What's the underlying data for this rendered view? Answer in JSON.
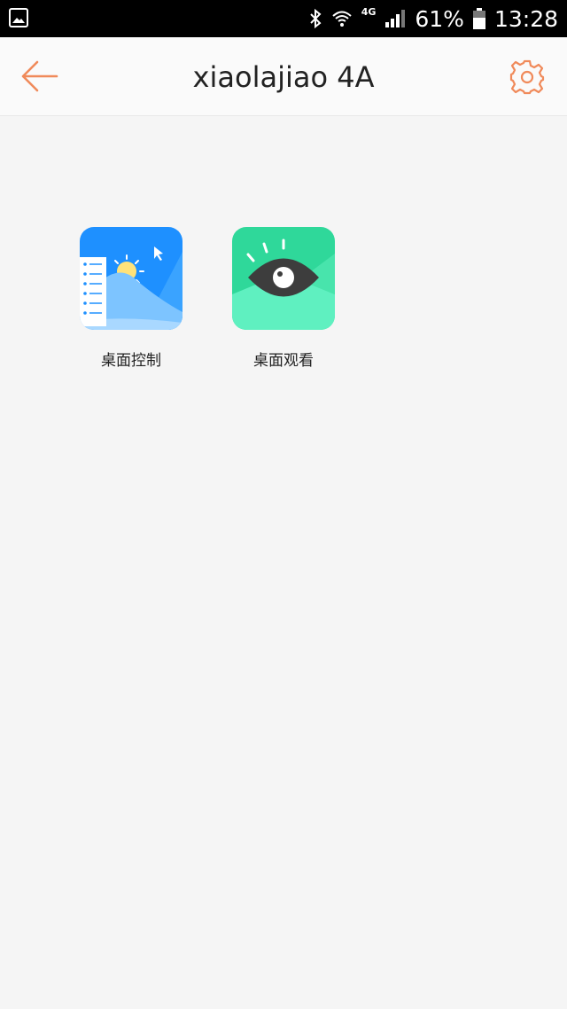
{
  "status_bar": {
    "network": "4G",
    "battery_percent": "61%",
    "time": "13:28",
    "icons": [
      "gallery-icon",
      "bluetooth-icon",
      "wifi-icon",
      "signal-icon",
      "battery-icon"
    ]
  },
  "header": {
    "title": "xiaolajiao 4A",
    "accent_color": "#f08a5a",
    "icons": [
      "back-arrow-icon",
      "gear-icon"
    ]
  },
  "apps": [
    {
      "label": "桌面控制",
      "icon": "desktop-control-icon",
      "color": "#1e90ff"
    },
    {
      "label": "桌面观看",
      "icon": "eye-icon",
      "color": "#2fd89a"
    }
  ]
}
